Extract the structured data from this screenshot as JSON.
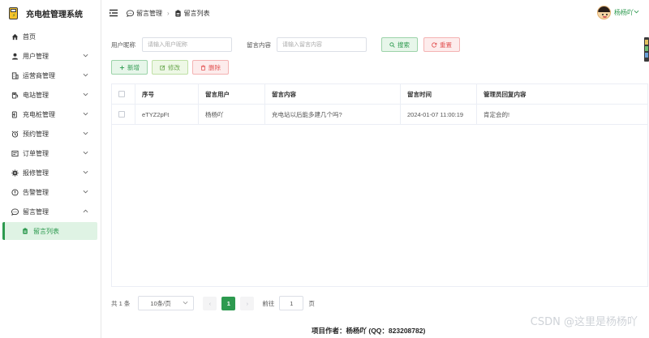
{
  "app": {
    "title": "充电桩管理系统"
  },
  "sidebar": {
    "items": [
      {
        "label": "首页",
        "icon": "home-icon",
        "expandable": false
      },
      {
        "label": "用户管理",
        "icon": "user-icon",
        "expandable": true
      },
      {
        "label": "运营商管理",
        "icon": "building-icon",
        "expandable": true
      },
      {
        "label": "电站管理",
        "icon": "station-icon",
        "expandable": true
      },
      {
        "label": "充电桩管理",
        "icon": "charger-icon",
        "expandable": true
      },
      {
        "label": "预约管理",
        "icon": "alarm-clock-icon",
        "expandable": true
      },
      {
        "label": "订单管理",
        "icon": "order-icon",
        "expandable": true
      },
      {
        "label": "报修管理",
        "icon": "gear-icon",
        "expandable": true
      },
      {
        "label": "告警管理",
        "icon": "alert-icon",
        "expandable": true
      },
      {
        "label": "留言管理",
        "icon": "chat-icon",
        "expandable": true,
        "expanded": true
      }
    ],
    "sub_item": {
      "label": "留言列表",
      "icon": "clipboard-icon"
    }
  },
  "header": {
    "breadcrumb": [
      {
        "label": "留言管理",
        "icon": "chat-icon"
      },
      {
        "label": "留言列表",
        "icon": "clipboard-icon"
      }
    ],
    "user_name": "杨杨吖"
  },
  "search": {
    "nickname_label": "用户昵称",
    "nickname_placeholder": "请输入用户昵称",
    "content_label": "留言内容",
    "content_placeholder": "请输入留言内容",
    "search_button": "搜索",
    "reset_button": "重置"
  },
  "actions": {
    "add": "新增",
    "edit": "修改",
    "delete": "删除"
  },
  "table": {
    "headers": [
      "序号",
      "留言用户",
      "留言内容",
      "留言时间",
      "管理员回复内容"
    ],
    "rows": [
      [
        "eTYZ2pFt",
        "杨杨吖",
        "充电站以后能多建几个吗?",
        "2024-01-07 11:00:19",
        "肯定会的!"
      ]
    ]
  },
  "pager": {
    "total": "共 1 条",
    "page_size": "10条/页",
    "current_page": "1",
    "goto_label": "前往",
    "goto_value": "1",
    "page_suffix": "页"
  },
  "footer": {
    "text": "项目作者：杨杨吖 (QQ：823208782)"
  },
  "watermark": "CSDN @这里是杨杨吖",
  "colors": {
    "accent": "#2d9a4f",
    "danger": "#e25555"
  }
}
